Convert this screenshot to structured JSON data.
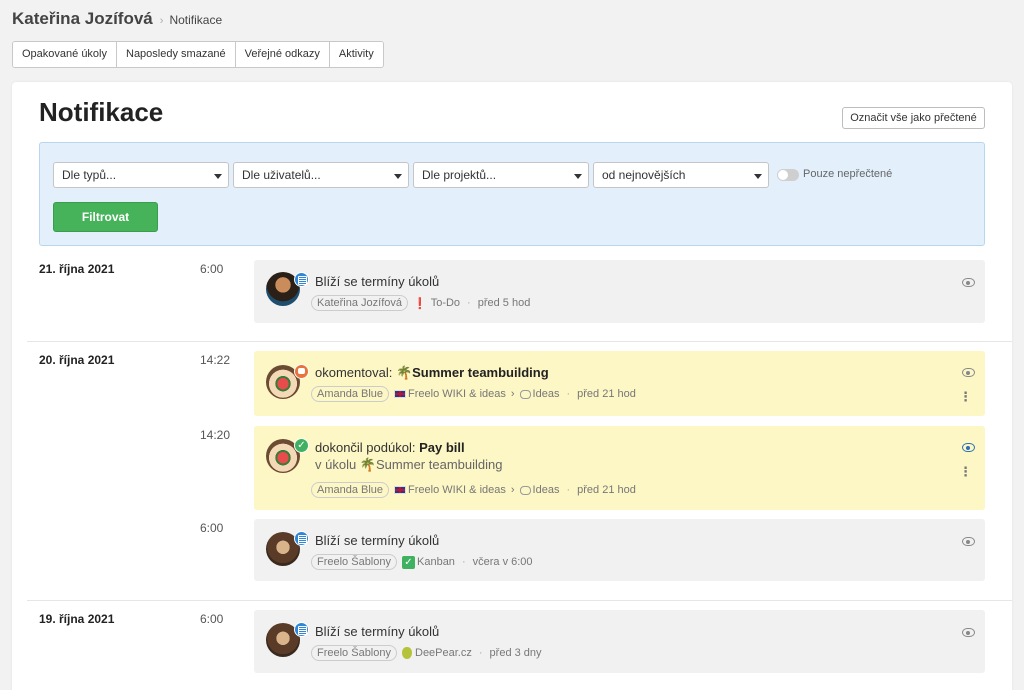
{
  "breadcrumb": {
    "user": "Kateřina Jozífová",
    "separator": "›",
    "page": "Notifikace"
  },
  "tabs": [
    {
      "label": "Opakované úkoly"
    },
    {
      "label": "Naposledy smazané"
    },
    {
      "label": "Veřejné odkazy"
    },
    {
      "label": "Aktivity"
    }
  ],
  "page": {
    "title": "Notifikace",
    "mark_all_label": "Označit vše jako přečtené"
  },
  "filters": {
    "type": "Dle typů...",
    "users": "Dle uživatelů...",
    "projects": "Dle projektů...",
    "sort": "od nejnovějších",
    "unread_only_label": "Pouze nepřečtené",
    "unread_only": false,
    "submit_label": "Filtrovat"
  },
  "groups": [
    {
      "date": "21. října 2021",
      "items": [
        {
          "time": "6:00",
          "text": "Blíží se termíny úkolů",
          "user": "Kateřina Jozífová",
          "list": "To-Do",
          "ago": "před 5 hod"
        }
      ]
    },
    {
      "date": "20. října 2021",
      "items": [
        {
          "time": "14:22",
          "action": "okomentoval:",
          "task": "Summer teambuilding",
          "user": "Amanda Blue",
          "project": "Freelo WIKI & ideas",
          "list": "Ideas",
          "ago": "před 21 hod"
        },
        {
          "time": "14:20",
          "action": "dokončil podúkol:",
          "task": "Pay bill",
          "sub_prefix": "v úkolu",
          "sub_task": "Summer teambuilding",
          "user": "Amanda Blue",
          "project": "Freelo WIKI & ideas",
          "list": "Ideas",
          "ago": "před 21 hod"
        },
        {
          "time": "6:00",
          "text": "Blíží se termíny úkolů",
          "user": "Freelo Šablony",
          "list": "Kanban",
          "ago": "včera v 6:00"
        }
      ]
    },
    {
      "date": "19. října 2021",
      "items": [
        {
          "time": "6:00",
          "text": "Blíží se termíny úkolů",
          "user": "Freelo Šablony",
          "list": "DeePear.cz",
          "ago": "před 3 dny"
        }
      ]
    }
  ],
  "icons": {
    "palm": "🌴",
    "exclamation": "❗",
    "check": "✓",
    "chevron": "›",
    "kebab": "⋮"
  }
}
